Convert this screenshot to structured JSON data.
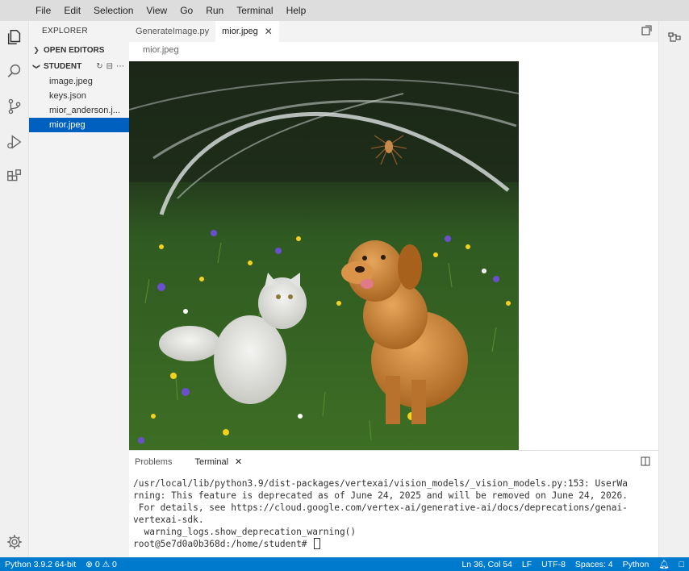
{
  "menu": [
    "File",
    "Edit",
    "Selection",
    "View",
    "Go",
    "Run",
    "Terminal",
    "Help"
  ],
  "activity_icons": [
    "explorer-icon",
    "search-icon",
    "source-control-icon",
    "run-debug-icon",
    "extensions-icon",
    "settings-gear-icon"
  ],
  "sidebar": {
    "title": "EXPLORER",
    "open_editors": "OPEN EDITORS",
    "folder": "STUDENT",
    "files": [
      "image.jpeg",
      "keys.json",
      "mior_anderson.j...",
      "mior.jpeg"
    ],
    "active_index": 3
  },
  "tabs": [
    {
      "label": "GenerateImage.py",
      "active": false
    },
    {
      "label": "mior.jpeg",
      "active": true,
      "close": "✕"
    }
  ],
  "breadcrumb": "mior.jpeg",
  "panel": {
    "tabs": [
      "Problems",
      "Terminal"
    ],
    "close": "✕",
    "terminal_lines": [
      "/usr/local/lib/python3.9/dist-packages/vertexai/vision_models/_vision_models.py:153: UserWa",
      "rning: This feature is deprecated as of June 24, 2025 and will be removed on June 24, 2026.",
      " For details, see https://cloud.google.com/vertex-ai/generative-ai/docs/deprecations/genai-",
      "vertexai-sdk.",
      "  warning_logs.show_deprecation_warning()"
    ],
    "prompt": "root@5e7d0a0b368d:/home/student# "
  },
  "status": {
    "python": "Python 3.9.2 64-bit",
    "errors": "0",
    "warnings": "0",
    "position": "Ln 36, Col 54",
    "eol": "LF",
    "encoding": "UTF-8",
    "spaces": "Spaces: 4",
    "language": "Python"
  },
  "colors": {
    "statusbar": "#007acc",
    "selection": "#0060c0"
  }
}
